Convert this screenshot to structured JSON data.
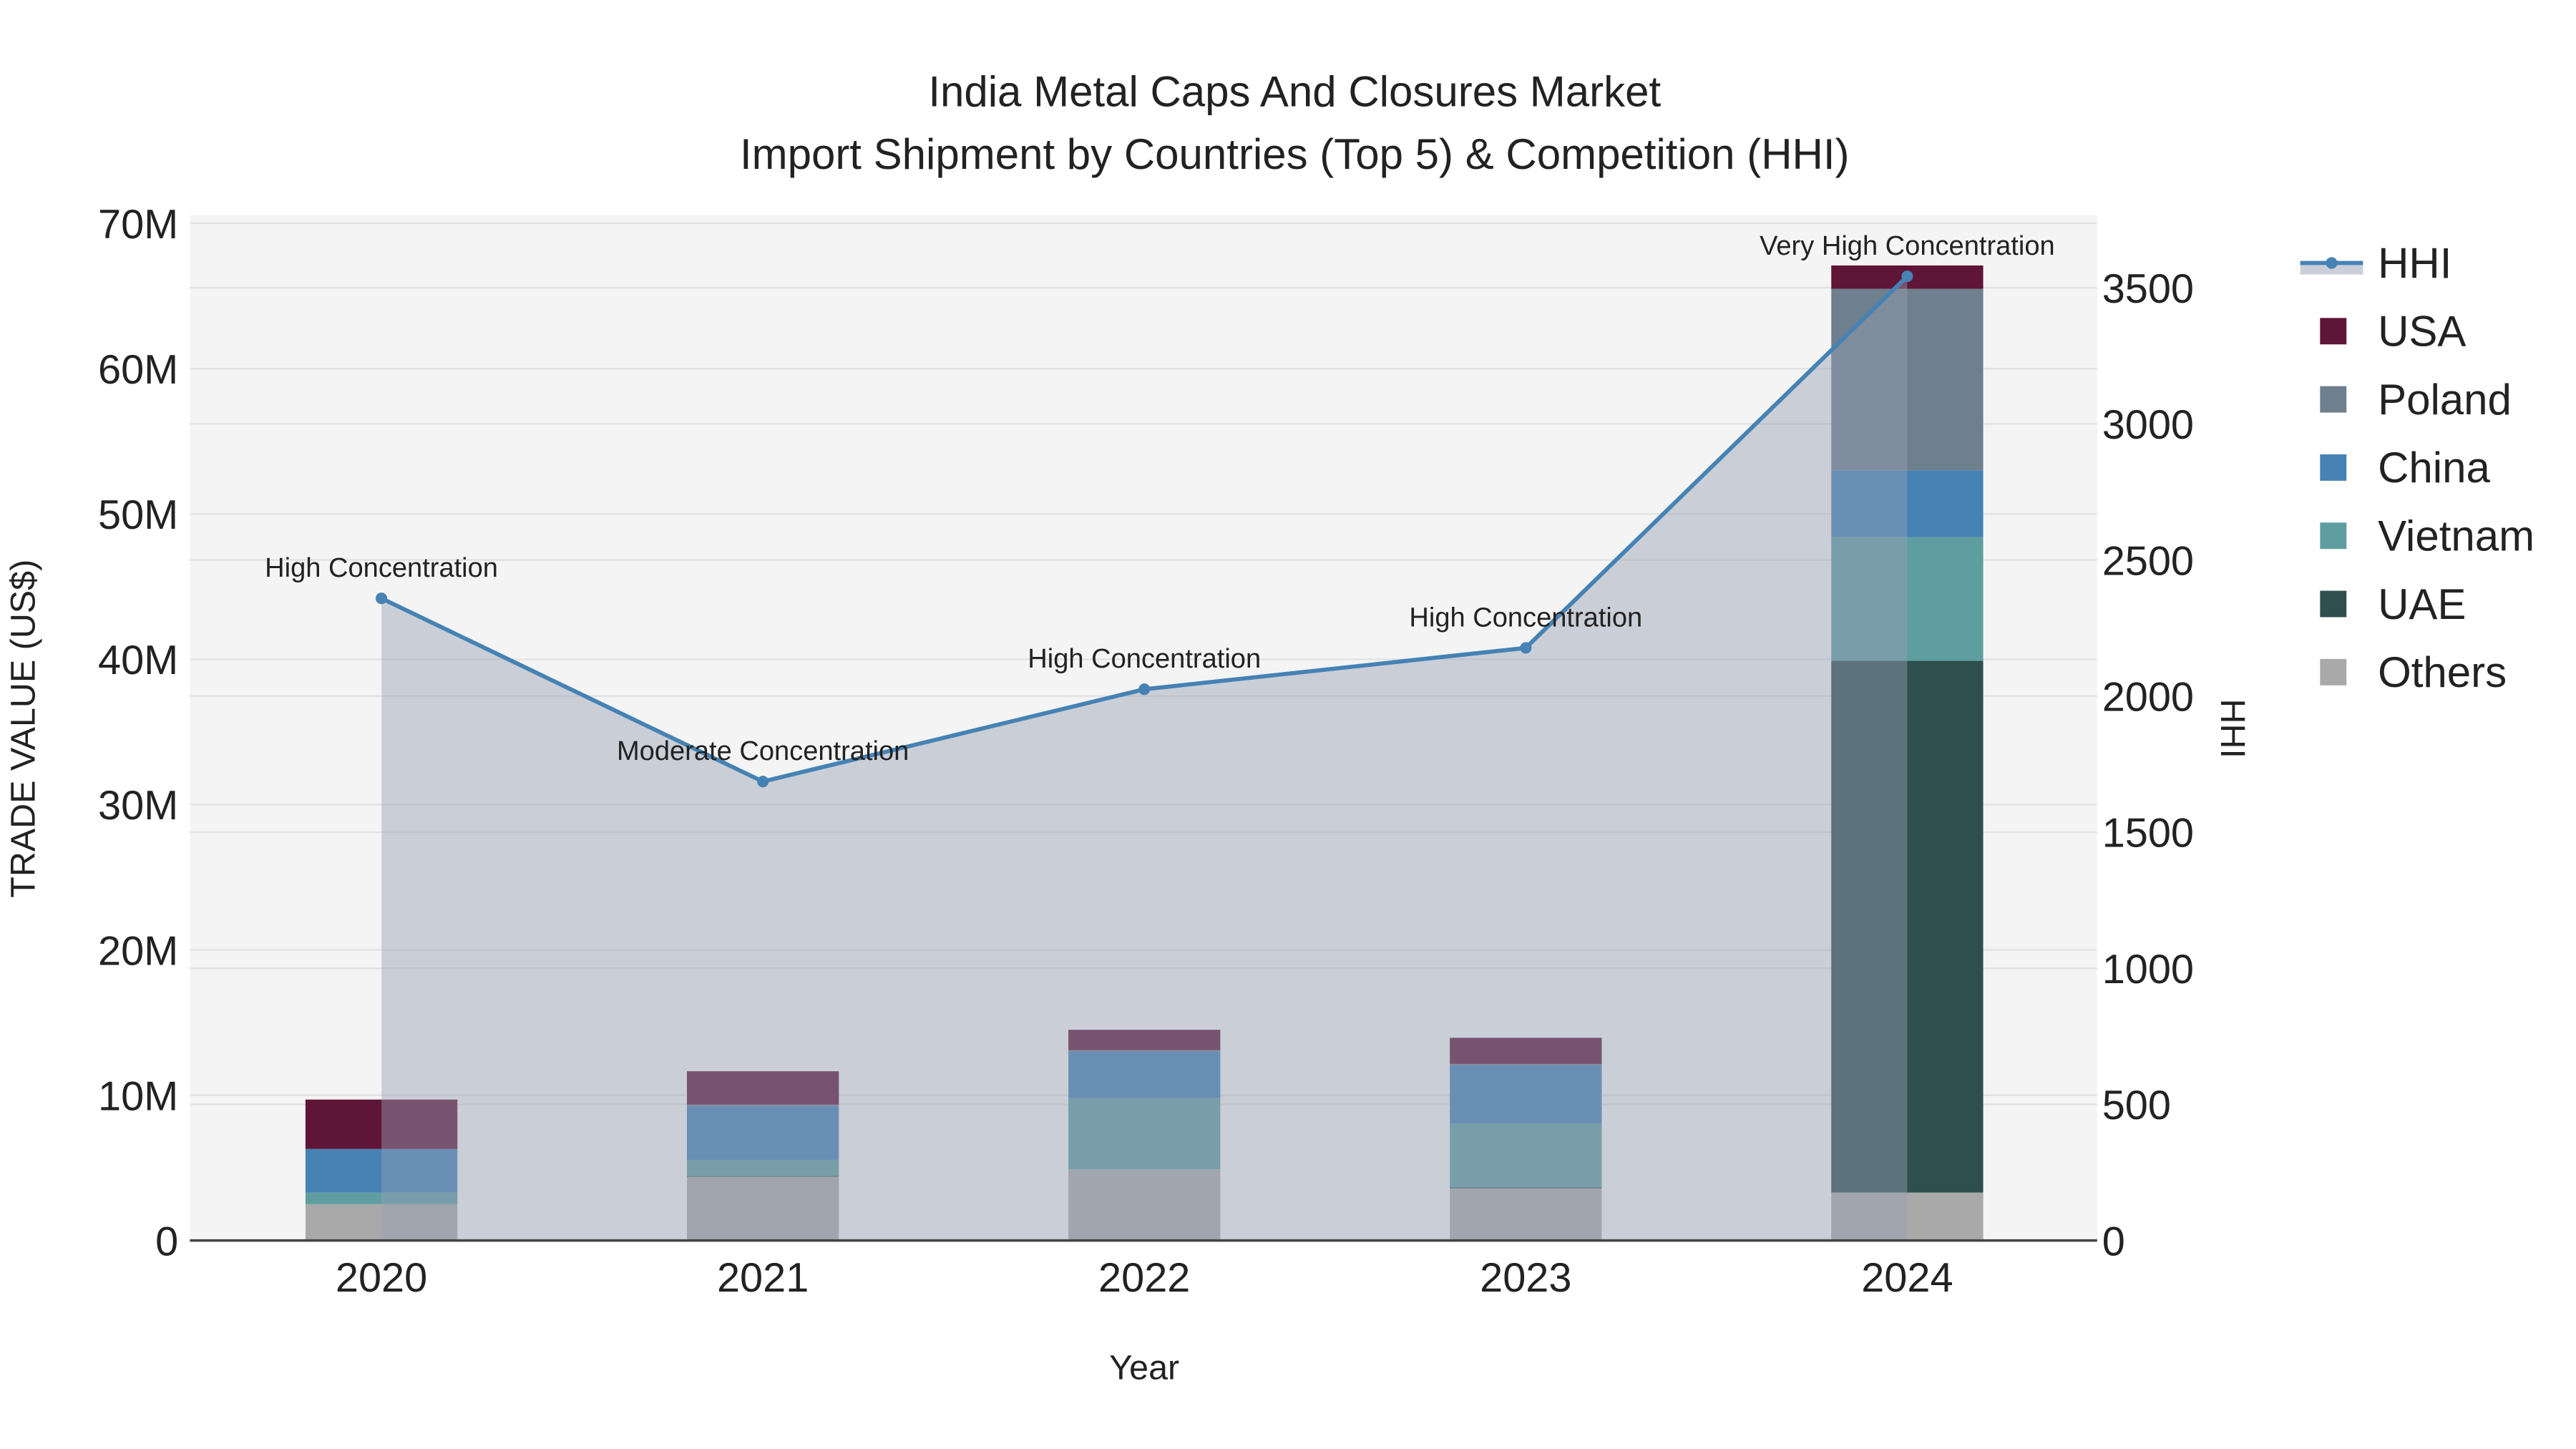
{
  "chart_data": {
    "type": "bar",
    "title": "India Metal Caps And Closures Market",
    "subtitle": "Import Shipment by Countries (Top 5) & Competition (HHI)",
    "xlabel": "Year",
    "ylabel": "TRADE VALUE (US$)",
    "y2label": "HHI",
    "categories": [
      "2020",
      "2021",
      "2022",
      "2023",
      "2024"
    ],
    "ylim": [
      0,
      70000000
    ],
    "y_ticks": [
      0,
      10000000,
      20000000,
      30000000,
      40000000,
      50000000,
      60000000,
      70000000
    ],
    "y_tick_labels": [
      "0",
      "10M",
      "20M",
      "30M",
      "40M",
      "50M",
      "60M",
      "70M"
    ],
    "y2lim": [
      0,
      3760
    ],
    "y2_ticks": [
      0,
      500,
      1000,
      1500,
      2000,
      2500,
      3000,
      3500
    ],
    "y2_tick_labels": [
      "0",
      "500",
      "1000",
      "1500",
      "2000",
      "2500",
      "3000",
      "3500"
    ],
    "grid": true,
    "legend_position": "right",
    "series": [
      {
        "name": "Others",
        "color": "#a9a9a9",
        "values": [
          2500000,
          4400000,
          4900000,
          3600000,
          3300000
        ]
      },
      {
        "name": "UAE",
        "color": "#2f4f4f",
        "values": [
          0,
          50000,
          0,
          50000,
          36600000
        ]
      },
      {
        "name": "Vietnam",
        "color": "#5f9ea0",
        "values": [
          800000,
          1100000,
          4900000,
          4400000,
          8500000
        ]
      },
      {
        "name": "China",
        "color": "#4682b4",
        "values": [
          3000000,
          3700000,
          3200000,
          4000000,
          4600000
        ]
      },
      {
        "name": "Poland",
        "color": "#6e7f8e",
        "values": [
          0,
          100000,
          100000,
          100000,
          12500000
        ]
      },
      {
        "name": "USA",
        "color": "#5f1537",
        "values": [
          3400000,
          2300000,
          1400000,
          1800000,
          1600000
        ]
      }
    ],
    "hhi": {
      "name": "HHI",
      "color": "#4682b4",
      "values": [
        2359,
        1686,
        2025,
        2177,
        3542
      ],
      "annotations": [
        "High Concentration",
        "Moderate Concentration",
        "High Concentration",
        "High Concentration",
        "Very High Concentration"
      ]
    },
    "legend": [
      "HHI",
      "USA",
      "Poland",
      "China",
      "Vietnam",
      "UAE",
      "Others"
    ]
  }
}
